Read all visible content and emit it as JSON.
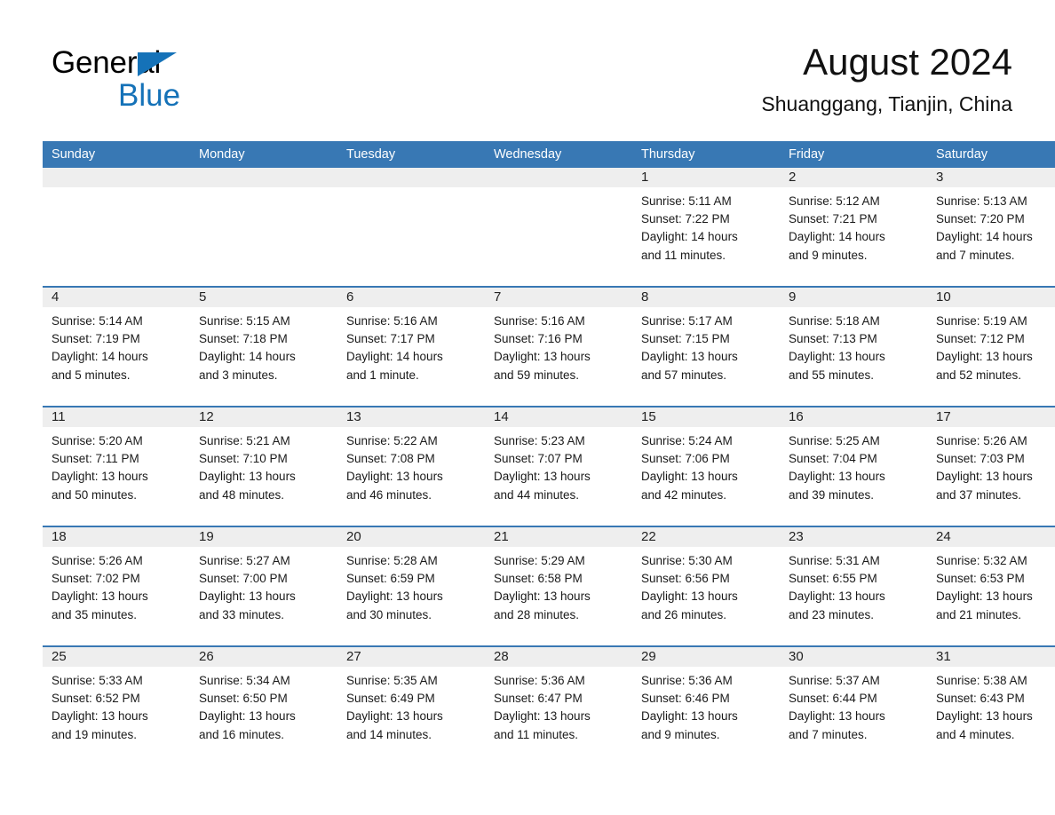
{
  "brand": {
    "line1": "General",
    "line2": "Blue",
    "triangle_color": "#1572b8"
  },
  "header": {
    "month_title": "August 2024",
    "location": "Shuanggang, Tianjin, China"
  },
  "theme": {
    "header_blue": "#3878b4",
    "daynum_band": "#eeeeee",
    "text": "#1a1a1a"
  },
  "weekdays": [
    "Sunday",
    "Monday",
    "Tuesday",
    "Wednesday",
    "Thursday",
    "Friday",
    "Saturday"
  ],
  "weeks": [
    [
      {
        "day": "",
        "sunrise": "",
        "sunset": "",
        "daylight": "",
        "daylight2": ""
      },
      {
        "day": "",
        "sunrise": "",
        "sunset": "",
        "daylight": "",
        "daylight2": ""
      },
      {
        "day": "",
        "sunrise": "",
        "sunset": "",
        "daylight": "",
        "daylight2": ""
      },
      {
        "day": "",
        "sunrise": "",
        "sunset": "",
        "daylight": "",
        "daylight2": ""
      },
      {
        "day": "1",
        "sunrise": "Sunrise: 5:11 AM",
        "sunset": "Sunset: 7:22 PM",
        "daylight": "Daylight: 14 hours",
        "daylight2": "and 11 minutes."
      },
      {
        "day": "2",
        "sunrise": "Sunrise: 5:12 AM",
        "sunset": "Sunset: 7:21 PM",
        "daylight": "Daylight: 14 hours",
        "daylight2": "and 9 minutes."
      },
      {
        "day": "3",
        "sunrise": "Sunrise: 5:13 AM",
        "sunset": "Sunset: 7:20 PM",
        "daylight": "Daylight: 14 hours",
        "daylight2": "and 7 minutes."
      }
    ],
    [
      {
        "day": "4",
        "sunrise": "Sunrise: 5:14 AM",
        "sunset": "Sunset: 7:19 PM",
        "daylight": "Daylight: 14 hours",
        "daylight2": "and 5 minutes."
      },
      {
        "day": "5",
        "sunrise": "Sunrise: 5:15 AM",
        "sunset": "Sunset: 7:18 PM",
        "daylight": "Daylight: 14 hours",
        "daylight2": "and 3 minutes."
      },
      {
        "day": "6",
        "sunrise": "Sunrise: 5:16 AM",
        "sunset": "Sunset: 7:17 PM",
        "daylight": "Daylight: 14 hours",
        "daylight2": "and 1 minute."
      },
      {
        "day": "7",
        "sunrise": "Sunrise: 5:16 AM",
        "sunset": "Sunset: 7:16 PM",
        "daylight": "Daylight: 13 hours",
        "daylight2": "and 59 minutes."
      },
      {
        "day": "8",
        "sunrise": "Sunrise: 5:17 AM",
        "sunset": "Sunset: 7:15 PM",
        "daylight": "Daylight: 13 hours",
        "daylight2": "and 57 minutes."
      },
      {
        "day": "9",
        "sunrise": "Sunrise: 5:18 AM",
        "sunset": "Sunset: 7:13 PM",
        "daylight": "Daylight: 13 hours",
        "daylight2": "and 55 minutes."
      },
      {
        "day": "10",
        "sunrise": "Sunrise: 5:19 AM",
        "sunset": "Sunset: 7:12 PM",
        "daylight": "Daylight: 13 hours",
        "daylight2": "and 52 minutes."
      }
    ],
    [
      {
        "day": "11",
        "sunrise": "Sunrise: 5:20 AM",
        "sunset": "Sunset: 7:11 PM",
        "daylight": "Daylight: 13 hours",
        "daylight2": "and 50 minutes."
      },
      {
        "day": "12",
        "sunrise": "Sunrise: 5:21 AM",
        "sunset": "Sunset: 7:10 PM",
        "daylight": "Daylight: 13 hours",
        "daylight2": "and 48 minutes."
      },
      {
        "day": "13",
        "sunrise": "Sunrise: 5:22 AM",
        "sunset": "Sunset: 7:08 PM",
        "daylight": "Daylight: 13 hours",
        "daylight2": "and 46 minutes."
      },
      {
        "day": "14",
        "sunrise": "Sunrise: 5:23 AM",
        "sunset": "Sunset: 7:07 PM",
        "daylight": "Daylight: 13 hours",
        "daylight2": "and 44 minutes."
      },
      {
        "day": "15",
        "sunrise": "Sunrise: 5:24 AM",
        "sunset": "Sunset: 7:06 PM",
        "daylight": "Daylight: 13 hours",
        "daylight2": "and 42 minutes."
      },
      {
        "day": "16",
        "sunrise": "Sunrise: 5:25 AM",
        "sunset": "Sunset: 7:04 PM",
        "daylight": "Daylight: 13 hours",
        "daylight2": "and 39 minutes."
      },
      {
        "day": "17",
        "sunrise": "Sunrise: 5:26 AM",
        "sunset": "Sunset: 7:03 PM",
        "daylight": "Daylight: 13 hours",
        "daylight2": "and 37 minutes."
      }
    ],
    [
      {
        "day": "18",
        "sunrise": "Sunrise: 5:26 AM",
        "sunset": "Sunset: 7:02 PM",
        "daylight": "Daylight: 13 hours",
        "daylight2": "and 35 minutes."
      },
      {
        "day": "19",
        "sunrise": "Sunrise: 5:27 AM",
        "sunset": "Sunset: 7:00 PM",
        "daylight": "Daylight: 13 hours",
        "daylight2": "and 33 minutes."
      },
      {
        "day": "20",
        "sunrise": "Sunrise: 5:28 AM",
        "sunset": "Sunset: 6:59 PM",
        "daylight": "Daylight: 13 hours",
        "daylight2": "and 30 minutes."
      },
      {
        "day": "21",
        "sunrise": "Sunrise: 5:29 AM",
        "sunset": "Sunset: 6:58 PM",
        "daylight": "Daylight: 13 hours",
        "daylight2": "and 28 minutes."
      },
      {
        "day": "22",
        "sunrise": "Sunrise: 5:30 AM",
        "sunset": "Sunset: 6:56 PM",
        "daylight": "Daylight: 13 hours",
        "daylight2": "and 26 minutes."
      },
      {
        "day": "23",
        "sunrise": "Sunrise: 5:31 AM",
        "sunset": "Sunset: 6:55 PM",
        "daylight": "Daylight: 13 hours",
        "daylight2": "and 23 minutes."
      },
      {
        "day": "24",
        "sunrise": "Sunrise: 5:32 AM",
        "sunset": "Sunset: 6:53 PM",
        "daylight": "Daylight: 13 hours",
        "daylight2": "and 21 minutes."
      }
    ],
    [
      {
        "day": "25",
        "sunrise": "Sunrise: 5:33 AM",
        "sunset": "Sunset: 6:52 PM",
        "daylight": "Daylight: 13 hours",
        "daylight2": "and 19 minutes."
      },
      {
        "day": "26",
        "sunrise": "Sunrise: 5:34 AM",
        "sunset": "Sunset: 6:50 PM",
        "daylight": "Daylight: 13 hours",
        "daylight2": "and 16 minutes."
      },
      {
        "day": "27",
        "sunrise": "Sunrise: 5:35 AM",
        "sunset": "Sunset: 6:49 PM",
        "daylight": "Daylight: 13 hours",
        "daylight2": "and 14 minutes."
      },
      {
        "day": "28",
        "sunrise": "Sunrise: 5:36 AM",
        "sunset": "Sunset: 6:47 PM",
        "daylight": "Daylight: 13 hours",
        "daylight2": "and 11 minutes."
      },
      {
        "day": "29",
        "sunrise": "Sunrise: 5:36 AM",
        "sunset": "Sunset: 6:46 PM",
        "daylight": "Daylight: 13 hours",
        "daylight2": "and 9 minutes."
      },
      {
        "day": "30",
        "sunrise": "Sunrise: 5:37 AM",
        "sunset": "Sunset: 6:44 PM",
        "daylight": "Daylight: 13 hours",
        "daylight2": "and 7 minutes."
      },
      {
        "day": "31",
        "sunrise": "Sunrise: 5:38 AM",
        "sunset": "Sunset: 6:43 PM",
        "daylight": "Daylight: 13 hours",
        "daylight2": "and 4 minutes."
      }
    ]
  ]
}
